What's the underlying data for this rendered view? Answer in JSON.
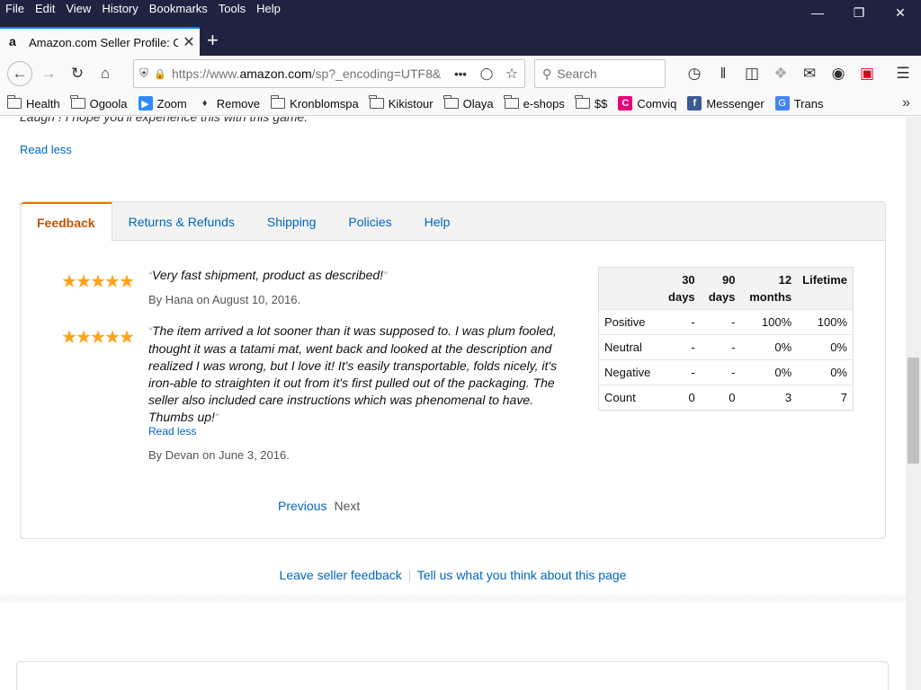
{
  "menu": [
    "File",
    "Edit",
    "View",
    "History",
    "Bookmarks",
    "Tools",
    "Help"
  ],
  "tab": {
    "title": "Amazon.com Seller Profile: Olaya",
    "favicon": "a"
  },
  "url": {
    "prefix": "https://www.",
    "domain": "amazon.com",
    "suffix": "/sp?_encoding=UTF8&"
  },
  "search": {
    "placeholder": "Search"
  },
  "bookmarks": [
    {
      "label": "Health",
      "icon": "folder-icon"
    },
    {
      "label": "Ogoola",
      "icon": "folder-icon"
    },
    {
      "label": "Zoom",
      "icon": "zoom-icon"
    },
    {
      "label": "Remove",
      "icon": "remove-icon"
    },
    {
      "label": "Kronblomspa",
      "icon": "folder-icon"
    },
    {
      "label": "Kikistour",
      "icon": "folder-icon"
    },
    {
      "label": "Olaya",
      "icon": "folder-icon"
    },
    {
      "label": "e-shops",
      "icon": "folder-icon"
    },
    {
      "label": "$$",
      "icon": "folder-icon"
    },
    {
      "label": "Comviq",
      "icon": "comviq-icon"
    },
    {
      "label": "Messenger",
      "icon": "facebook-icon"
    },
    {
      "label": "Trans",
      "icon": "translate-icon"
    }
  ],
  "page": {
    "cut_text": "Laugh ! I hope you'll experience this with this game.",
    "read_less_top": "Read less",
    "tabs": [
      "Feedback",
      "Returns & Refunds",
      "Shipping",
      "Policies",
      "Help"
    ],
    "reviews": [
      {
        "stars": 5,
        "text": "Very fast shipment, product as described!",
        "by": "By Hana on August 10, 2016."
      },
      {
        "stars": 5,
        "text": "The item arrived a lot sooner than it was supposed to. I was plum fooled, thought it was a tatami mat, went back and looked at the description and realized I was wrong, but I love it! It's easily transportable, folds nicely, it's iron-able to straighten it out from it's first pulled out of the packaging. The seller also included care instructions which was phenomenal to have. Thumbs up!",
        "read_less": "Read less",
        "by": "By Devan on June 3, 2016."
      }
    ],
    "ratings_table": {
      "headers": [
        "",
        "30 days",
        "90 days",
        "12 months",
        "Lifetime"
      ],
      "rows": [
        {
          "label": "Positive",
          "d30": "-",
          "d90": "-",
          "m12": "100%",
          "life": "100%"
        },
        {
          "label": "Neutral",
          "d30": "-",
          "d90": "-",
          "m12": "0%",
          "life": "0%"
        },
        {
          "label": "Negative",
          "d30": "-",
          "d90": "-",
          "m12": "0%",
          "life": "0%"
        },
        {
          "label": "Count",
          "d30": "0",
          "d90": "0",
          "m12": "3",
          "life": "7"
        }
      ]
    },
    "pager": {
      "previous": "Previous",
      "next": "Next"
    },
    "footer_links": [
      "Leave seller feedback",
      "Tell us what you think about this page"
    ]
  },
  "colors": {
    "titlebar": "#202340",
    "link": "#0066c0",
    "active_tab": "#c45500",
    "star": "#ffa41c",
    "positive": "#067d62",
    "negative": "#cc0c39"
  }
}
